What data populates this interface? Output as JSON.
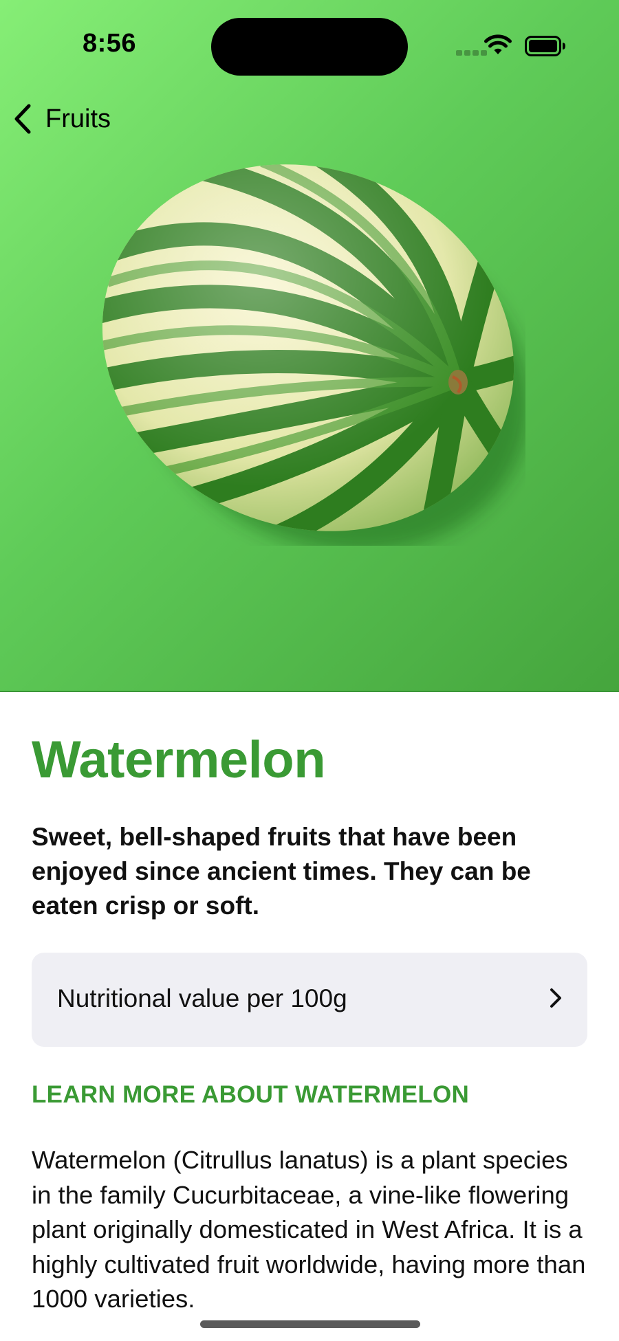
{
  "status_bar": {
    "time": "8:56",
    "icons": [
      "cellular-signal-icon",
      "wifi-icon",
      "battery-icon"
    ]
  },
  "nav": {
    "back_label": "Fruits",
    "back_icon": "chevron-left-icon"
  },
  "hero": {
    "image": "watermelon-image",
    "gradient": [
      "#86ee76",
      "#5fcb58",
      "#45a53d"
    ]
  },
  "fruit": {
    "name": "Watermelon",
    "description": "Sweet, bell-shaped fruits that have been enjoyed since ancient times. They can be eaten crisp or soft.",
    "nutrition_label": "Nutritional value per 100g",
    "learn_more_header": "LEARN MORE ABOUT WATERMELON",
    "body": "Watermelon (Citrullus lanatus) is a plant species in the family Cucurbitaceae, a vine-like flowering plant originally domesticated in West Africa. It is a highly cultivated fruit worldwide, having more than 1000 varieties."
  },
  "colors": {
    "accent": "#3a9a34",
    "row_background": "#efeff4"
  }
}
